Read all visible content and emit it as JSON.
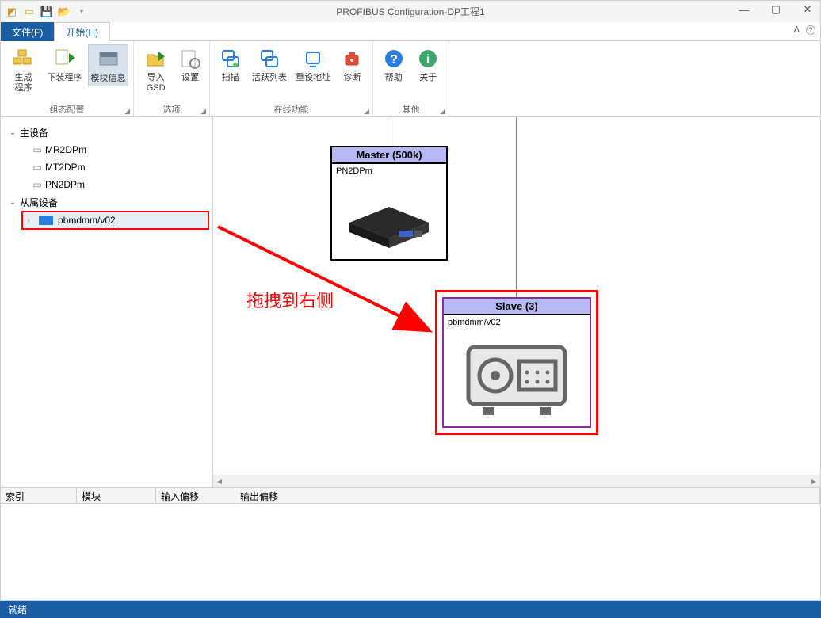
{
  "title": "PROFIBUS Configuration-DP工程1",
  "tabs": {
    "file": "文件(F)",
    "start": "开始(H)"
  },
  "ribbon": {
    "group1": {
      "title": "组态配置",
      "btn1": "生成\n程序",
      "btn2": "下装程序",
      "btn3": "模块信息"
    },
    "group2": {
      "title": "选项",
      "btn1": "导入\nGSD",
      "btn2": "设置"
    },
    "group3": {
      "title": "在线功能",
      "btn1": "扫描",
      "btn2": "活跃列表",
      "btn3": "重设地址",
      "btn4": "诊断"
    },
    "group4": {
      "title": "其他",
      "btn1": "帮助",
      "btn2": "关于"
    }
  },
  "tree": {
    "master": "主设备",
    "m1": "MR2DPm",
    "m2": "MT2DPm",
    "m3": "PN2DPm",
    "slave": "从属设备",
    "s1": "pbmdmm/v02"
  },
  "canvas": {
    "master_title": "Master (500k)",
    "master_sub": "PN2DPm",
    "slave_title": "Slave (3)",
    "slave_sub": "pbmdmm/v02",
    "annotation": "拖拽到右侧"
  },
  "grid": {
    "c1": "索引",
    "c2": "模块",
    "c3": "输入偏移",
    "c4": "输出偏移"
  },
  "status": "就绪"
}
